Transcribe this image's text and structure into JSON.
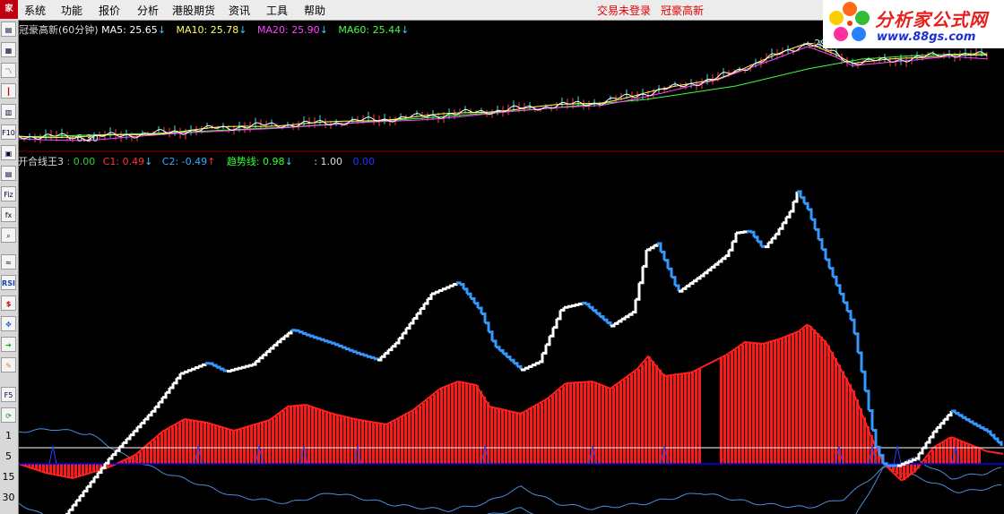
{
  "menubar": {
    "logo": "家",
    "items": [
      "系统",
      "功能",
      "报价",
      "分析",
      "港股期货",
      "资讯",
      "工具",
      "帮助"
    ],
    "login_status": "交易未登录",
    "stock_name": "冠豪高新"
  },
  "watermark": {
    "title": "分析家公式网",
    "url": "www.88gs.com"
  },
  "toolbar": {
    "buttons": [
      "list",
      "grid",
      "trend",
      "candle",
      "table",
      "F10",
      "news",
      "F8",
      "Fiz",
      "fx",
      "zoom",
      "wave",
      "RSI",
      "$",
      "move",
      "enter",
      "draw",
      "F5",
      "sync"
    ],
    "periods": [
      "1",
      "5",
      "15",
      "30"
    ]
  },
  "upper_panel": {
    "stock_label": "冠豪高新(60分钟)",
    "ma": [
      {
        "name": "MA5",
        "value": "25.65",
        "color": "#ffffff"
      },
      {
        "name": "MA10",
        "value": "25.78",
        "color": "#ffff66"
      },
      {
        "name": "MA20",
        "value": "25.90",
        "color": "#ff44ff"
      },
      {
        "name": "MA60",
        "value": "25.44",
        "color": "#44ff44"
      }
    ],
    "low_marker": "6.30",
    "high_marker": "29"
  },
  "lower_panel": {
    "indicator_name": "开合线王3",
    "items": [
      {
        "label": ": 0.00",
        "color": "#33cc33"
      },
      {
        "label": "C1: 0.49",
        "color": "#ff3333"
      },
      {
        "label": "C2: -0.49",
        "color": "#33aaff"
      },
      {
        "label": "趋势线: 0.98",
        "color": "#33ff33"
      },
      {
        "label": ": 1.00",
        "color": "#dddddd"
      },
      {
        "label": "0.00",
        "color": "#2233ff"
      }
    ]
  },
  "colors": {
    "trend_up": "#ffffff",
    "trend_down": "#3399ff",
    "bar": "#ff1a1a",
    "c1_line": "#ff2020",
    "band": "#4a8cd8",
    "baseline": "#0000ff",
    "grid_line": "#ffffff",
    "spike": "#2244ff"
  }
}
